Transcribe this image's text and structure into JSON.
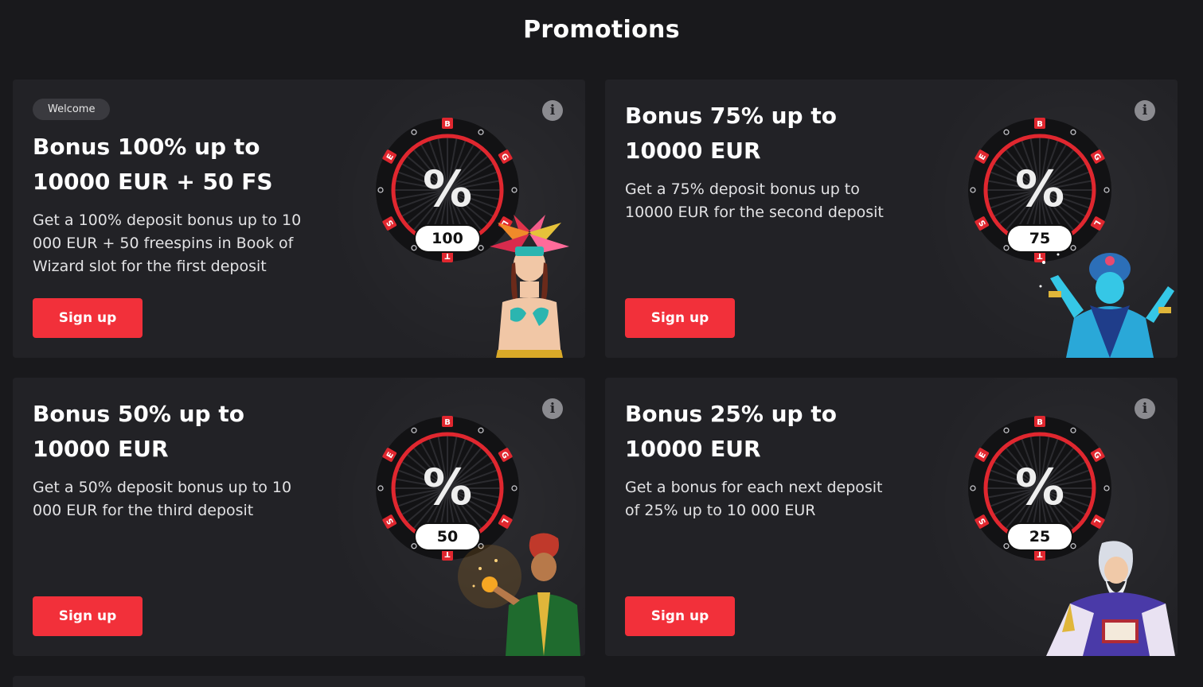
{
  "page": {
    "title": "Promotions"
  },
  "colors": {
    "accent": "#f2303a",
    "card_bg": "#222226",
    "page_bg": "#19191c"
  },
  "cards": [
    {
      "badge": "Welcome",
      "title": "Bonus 100% up to\n10000 EUR + 50 FS",
      "description": "Get a 100% deposit bonus up to 10\n000 EUR + 50 freespins in Book of\nWizard slot for the first deposit",
      "button": "Sign up",
      "wheel_value": "100",
      "info_icon": "info-icon",
      "character": "feathered-dancer"
    },
    {
      "title": "Bonus 75% up to\n10000 EUR",
      "description": "Get a 75% deposit bonus up to\n10000 EUR for the second deposit",
      "button": "Sign up",
      "wheel_value": "75",
      "info_icon": "info-icon",
      "character": "genie"
    },
    {
      "title": "Bonus 50% up to\n10000 EUR",
      "description": "Get a 50% deposit bonus up to 10\n000 EUR for the third deposit",
      "button": "Sign up",
      "wheel_value": "50",
      "info_icon": "info-icon",
      "character": "sultan"
    },
    {
      "title": "Bonus 25% up to\n10000 EUR",
      "description": "Get a bonus for each next deposit\nof 25% up to 10 000 EUR",
      "button": "Sign up",
      "wheel_value": "25",
      "info_icon": "info-icon",
      "character": "wizard"
    }
  ],
  "wheel_letters": [
    "B",
    "G",
    "L",
    "T",
    "S",
    "E"
  ]
}
